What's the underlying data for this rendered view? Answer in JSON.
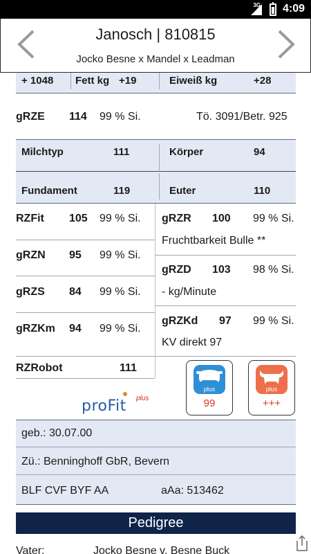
{
  "statusbar": {
    "network": "3G",
    "time": "4:09"
  },
  "header": {
    "title": "Janosch | 810815",
    "subtitle": "Jocko Besne x Mandel x Leadman",
    "prev_icon": "chevron-left-icon",
    "next_icon": "chevron-right-icon"
  },
  "milk_row": {
    "milk": "+ 1048",
    "fat_label": "Fett kg",
    "fat_value": "+19",
    "protein_label": "Eiweiß kg",
    "protein_value": "+28"
  },
  "grze": {
    "label": "gRZE",
    "value": "114",
    "reliability": "99 % Si.",
    "info": "Tö. 3091/Betr. 925"
  },
  "exterior": {
    "milchtyp_label": "Milchtyp",
    "milchtyp_value": "111",
    "koerper_label": "Körper",
    "koerper_value": "94",
    "fundament_label": "Fundament",
    "fundament_value": "119",
    "euter_label": "Euter",
    "euter_value": "110"
  },
  "left_indices": [
    {
      "label": "RZFit",
      "value": "105",
      "reliability": "99 % Si."
    },
    {
      "label": "gRZN",
      "value": "95",
      "reliability": "99 % Si."
    },
    {
      "label": "gRZS",
      "value": "84",
      "reliability": "99 % Si."
    },
    {
      "label": "gRZKm",
      "value": "94",
      "reliability": "99 % Si."
    }
  ],
  "right_indices": {
    "grzr": {
      "label": "gRZR",
      "value": "100",
      "reliability": "99 % Si.",
      "note": "Fruchtbarkeit Bulle **"
    },
    "grzd": {
      "label": "gRZD",
      "value": "103",
      "reliability": "98 % Si.",
      "note": "- kg/Minute"
    },
    "grzkd": {
      "label": "gRZKd",
      "value": "97",
      "reliability": "99 % Si.",
      "note": "KV direkt  97"
    }
  },
  "robot": {
    "label": "RZRobot",
    "value": "111"
  },
  "profit_logo": {
    "word": "proFit",
    "suffix": "plus"
  },
  "apps": [
    {
      "name": "cow-plus-app",
      "color": "#2f8fd6",
      "label": "plus",
      "value": "99"
    },
    {
      "name": "bull-plus-app",
      "color": "#ee6f4b",
      "label": "plus",
      "value": "+++"
    }
  ],
  "info": {
    "birth": "geb.: 30.07.00",
    "breeder": "Zü.: Benninghoff GbR, Bevern",
    "codes": "BLF CVF BYF AA",
    "aaa": "aAa: 513462"
  },
  "pedigree": {
    "title": "Pedigree",
    "father_label": "Vater:",
    "father_value": "Jocko Besne v. Besne Buck"
  }
}
